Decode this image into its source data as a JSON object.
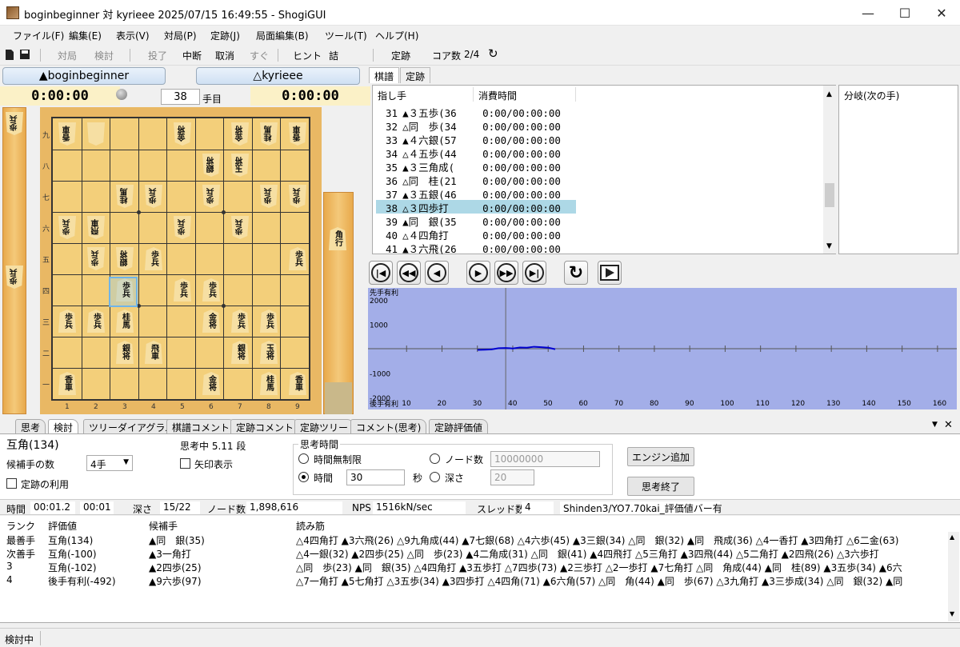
{
  "window": {
    "title": "boginbeginner 対 kyrieee 2025/07/15 16:49:55 - ShogiGUI",
    "minimize": "—",
    "maximize": "☐",
    "close": "✕"
  },
  "menu": [
    "ファイル(F)",
    "編集(E)",
    "表示(V)",
    "対局(P)",
    "定跡(J)",
    "局面編集(B)",
    "ツール(T)",
    "ヘルプ(H)"
  ],
  "toolbar": {
    "play": "対局",
    "analyze": "検討",
    "resign": "投了",
    "abort": "中断",
    "undo": "取消",
    "now": "すぐ",
    "hint": "ヒント",
    "mate": "詰",
    "joseki": "定跡",
    "cores": "コア数",
    "cores_val": "2/4"
  },
  "players": {
    "sente": "▲boginbeginner",
    "gote": "△kyrieee",
    "sente_clock": "0:00:00",
    "gote_clock": "0:00:00",
    "move_no": "38",
    "move_label": "手目"
  },
  "board": {
    "rows": [
      "九",
      "八",
      "七",
      "六",
      "五",
      "四",
      "三",
      "二",
      "一"
    ],
    "cols": [
      "1",
      "2",
      "3",
      "4",
      "5",
      "6",
      "7",
      "8",
      "9"
    ],
    "pieces": [
      {
        "r": 0,
        "c": 0,
        "t": "香車",
        "rev": true
      },
      {
        "r": 0,
        "c": 1,
        "t": "",
        "rev": true
      },
      {
        "r": 0,
        "c": 4,
        "t": "金将",
        "rev": true
      },
      {
        "r": 0,
        "c": 6,
        "t": "金将",
        "rev": true
      },
      {
        "r": 0,
        "c": 7,
        "t": "桂馬",
        "rev": true
      },
      {
        "r": 0,
        "c": 8,
        "t": "香車",
        "rev": true
      },
      {
        "r": 1,
        "c": 5,
        "t": "銀将",
        "rev": true
      },
      {
        "r": 1,
        "c": 6,
        "t": "玉将",
        "rev": true
      },
      {
        "r": 2,
        "c": 2,
        "t": "桂馬",
        "rev": true
      },
      {
        "r": 2,
        "c": 3,
        "t": "歩兵",
        "rev": true
      },
      {
        "r": 2,
        "c": 5,
        "t": "歩兵",
        "rev": true
      },
      {
        "r": 2,
        "c": 7,
        "t": "歩兵",
        "rev": true
      },
      {
        "r": 2,
        "c": 8,
        "t": "歩兵",
        "rev": true
      },
      {
        "r": 3,
        "c": 0,
        "t": "歩兵",
        "rev": true
      },
      {
        "r": 3,
        "c": 1,
        "t": "飛車",
        "rev": true
      },
      {
        "r": 3,
        "c": 4,
        "t": "歩兵",
        "rev": true
      },
      {
        "r": 3,
        "c": 6,
        "t": "歩兵",
        "rev": true
      },
      {
        "r": 4,
        "c": 1,
        "t": "歩兵",
        "rev": true
      },
      {
        "r": 4,
        "c": 2,
        "t": "銀将",
        "rev": true
      },
      {
        "r": 4,
        "c": 3,
        "t": "歩兵",
        "rev": false
      },
      {
        "r": 4,
        "c": 8,
        "t": "歩兵",
        "rev": false
      },
      {
        "r": 5,
        "c": 2,
        "t": "歩兵",
        "rev": false
      },
      {
        "r": 5,
        "c": 4,
        "t": "歩兵",
        "rev": false
      },
      {
        "r": 5,
        "c": 5,
        "t": "歩兵",
        "rev": false
      },
      {
        "r": 6,
        "c": 0,
        "t": "歩兵",
        "rev": false
      },
      {
        "r": 6,
        "c": 1,
        "t": "歩兵",
        "rev": false
      },
      {
        "r": 6,
        "c": 2,
        "t": "桂馬",
        "rev": false
      },
      {
        "r": 6,
        "c": 5,
        "t": "金将",
        "rev": false
      },
      {
        "r": 6,
        "c": 6,
        "t": "歩兵",
        "rev": false
      },
      {
        "r": 6,
        "c": 7,
        "t": "歩兵",
        "rev": false
      },
      {
        "r": 7,
        "c": 2,
        "t": "銀将",
        "rev": false
      },
      {
        "r": 7,
        "c": 3,
        "t": "飛車",
        "rev": false
      },
      {
        "r": 7,
        "c": 6,
        "t": "銀将",
        "rev": false
      },
      {
        "r": 7,
        "c": 7,
        "t": "玉将",
        "rev": false
      },
      {
        "r": 8,
        "c": 0,
        "t": "香車",
        "rev": false
      },
      {
        "r": 8,
        "c": 5,
        "t": "金将",
        "rev": false
      },
      {
        "r": 8,
        "c": 7,
        "t": "桂馬",
        "rev": false
      },
      {
        "r": 8,
        "c": 8,
        "t": "香車",
        "rev": false
      }
    ],
    "gote_hand": [
      "歩兵",
      "歩兵"
    ],
    "sente_hand": [
      "角行"
    ]
  },
  "kifu": {
    "tabs": [
      "棋譜",
      "定跡"
    ],
    "col_move": "指し手",
    "col_time": "消費時間",
    "branch_label": "分岐(次の手)",
    "rows": [
      {
        "n": "31",
        "m": "▲３五歩(36",
        "t": "0:00/00:00:00"
      },
      {
        "n": "32",
        "m": "△同　歩(34",
        "t": "0:00/00:00:00"
      },
      {
        "n": "33",
        "m": "▲４六銀(57",
        "t": "0:00/00:00:00"
      },
      {
        "n": "34",
        "m": "△４五歩(44",
        "t": "0:00/00:00:00"
      },
      {
        "n": "35",
        "m": "▲３三角成(",
        "t": "0:00/00:00:00"
      },
      {
        "n": "36",
        "m": "△同　桂(21",
        "t": "0:00/00:00:00"
      },
      {
        "n": "37",
        "m": "▲３五銀(46",
        "t": "0:00/00:00:00"
      },
      {
        "n": "38",
        "m": "△３四歩打",
        "t": "0:00/00:00:00"
      },
      {
        "n": "39",
        "m": "▲同　銀(35",
        "t": "0:00/00:00:00"
      },
      {
        "n": "40",
        "m": "△４四角打",
        "t": "0:00/00:00:00"
      },
      {
        "n": "41",
        "m": "▲３六飛(26",
        "t": "0:00/00:00:00"
      }
    ],
    "selected": 7
  },
  "graph": {
    "top_label": "先手有利",
    "bottom_label": "後手有利",
    "y_ticks": [
      "2000",
      "1000",
      "-1000",
      "-2000"
    ],
    "x_ticks": [
      "10",
      "20",
      "30",
      "40",
      "50",
      "60",
      "70",
      "80",
      "90",
      "100",
      "110",
      "120",
      "130",
      "140",
      "150",
      "160"
    ]
  },
  "chart_data": {
    "type": "line",
    "x": [
      30,
      32,
      34,
      36,
      38,
      40,
      42,
      44,
      46,
      48,
      50,
      52
    ],
    "values": [
      -50,
      -40,
      -30,
      20,
      30,
      10,
      50,
      40,
      80,
      60,
      40,
      -20
    ],
    "ylim": [
      -2500,
      2500
    ],
    "xlim": [
      0,
      165
    ]
  },
  "bottom_tabs": [
    "思考",
    "検討",
    "ツリーダイアグラム",
    "棋譜コメント",
    "定跡コメント",
    "定跡ツリー",
    "コメント(思考)",
    "定跡評価値"
  ],
  "analysis": {
    "eval": "互角(134)",
    "status": "思考中 5.11 段",
    "candidates_label": "候補手の数",
    "candidates_val": "4手",
    "arrows": "矢印表示",
    "use_joseki": "定跡の利用",
    "think_time": "思考時間",
    "unlimited": "時間無制限",
    "time": "時間",
    "time_val": "30",
    "sec": "秒",
    "node": "ノード数",
    "node_val": "10000000",
    "depth": "深さ",
    "depth_val": "20",
    "add_engine": "エンジン追加",
    "stop": "思考終了"
  },
  "stats": {
    "time_label": "時間",
    "time": "00:01.2",
    "time2": "00:01",
    "depth_label": "深さ",
    "depth": "15/22",
    "nodes_label": "ノード数",
    "nodes": "1,898,616",
    "nps_label": "NPS",
    "nps": "1516kN/sec",
    "threads_label": "スレッド数",
    "threads": "4",
    "engine": "Shinden3/YO7.70kai_評価値バー有"
  },
  "pv": {
    "h_rank": "ランク",
    "h_eval": "評価値",
    "h_move": "候補手",
    "h_line": "読み筋",
    "rows": [
      {
        "rank": "最善手",
        "eval": "互角(134)",
        "move": "▲同　銀(35)",
        "line": "△4四角打 ▲3六飛(26) △9九角成(44) ▲7七銀(68) △4六歩(45) ▲3三銀(34) △同　銀(32) ▲同　飛成(36) △4一香打 ▲3四角打 △6二金(63)"
      },
      {
        "rank": "次善手",
        "eval": "互角(-100)",
        "move": "▲3一角打",
        "line": "△4一銀(32) ▲2四歩(25) △同　歩(23) ▲4二角成(31) △同　銀(41) ▲4四飛打 △5三角打 ▲3四飛(44) △5二角打 ▲2四飛(26) △3六歩打"
      },
      {
        "rank": "3",
        "eval": "互角(-102)",
        "move": "▲2四歩(25)",
        "line": "△同　歩(23) ▲同　銀(35) △4四角打 ▲3五歩打 △7四歩(73) ▲2三歩打 △2一歩打 ▲7七角打 △同　角成(44) ▲同　桂(89) ▲3五歩(34) ▲6六"
      },
      {
        "rank": "4",
        "eval": "後手有利(-492)",
        "move": "▲9六歩(97)",
        "line": "△7一角打 ▲5七角打 △3五歩(34) ▲3四歩打 △4四角(71) ▲6六角(57) △同　角(44) ▲同　歩(67) △3九角打 ▲3三歩成(34) △同　銀(32) ▲同"
      }
    ]
  },
  "status": "検討中"
}
